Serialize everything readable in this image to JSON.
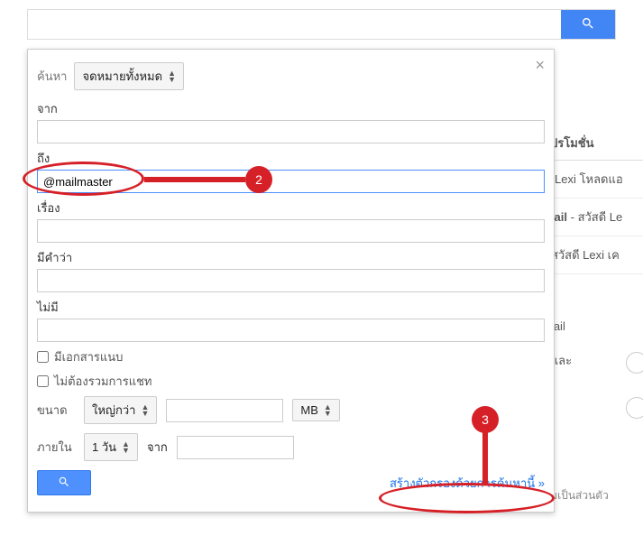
{
  "topbar": {
    "search_value": ""
  },
  "panel": {
    "search_label": "ค้นหา",
    "search_scope": "จดหมายทั้งหมด",
    "close": "×",
    "from_label": "จาก",
    "from_value": "",
    "to_label": "ถึง",
    "to_value": "@mailmaster",
    "subject_label": "เรื่อง",
    "subject_value": "",
    "has_words_label": "มีคำว่า",
    "has_words_value": "",
    "not_label": "ไม่มี",
    "not_value": "",
    "attach_label": "มีเอกสารแนบ",
    "exclude_chat_label": "ไม่ต้องรวมการแชท",
    "size_label": "ขนาด",
    "size_op": "ใหญ่กว่า",
    "size_value": "",
    "size_unit": "MB",
    "date_label": "ภายใน",
    "date_range": "1 วัน",
    "date_from_label": "จาก",
    "date_value": "",
    "filter_link": "สร้างตัวกรองด้วยการค้นหานี้ »"
  },
  "bg": {
    "promo_tab": "โปรโมชั่น",
    "row1": "ดี Lexi โหลดแอ",
    "row2_bold": "mail",
    "row2_rest": " - สวัสดี Le",
    "row3": " - สวัสดี Lexi เค",
    "row4": "mail",
    "row5": "อและ",
    "privacy": "อมเป็นส่วนตัว"
  },
  "annotations": {
    "marker2": "2",
    "marker3": "3"
  }
}
